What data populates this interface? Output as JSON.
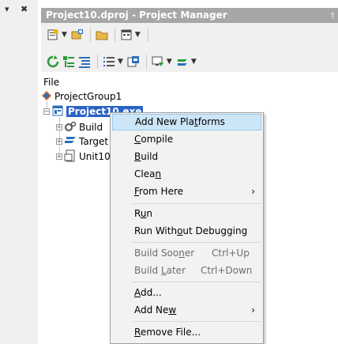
{
  "window": {
    "title": "Project10.dproj - Project Manager",
    "pin_glyph": "†"
  },
  "left_strip": {
    "dropdown_glyph": "▾",
    "close_glyph": "✖"
  },
  "tree": {
    "header": "File",
    "group": "ProjectGroup1",
    "project": "Project10.exe",
    "children": [
      "Build",
      "Target",
      "Unit10"
    ]
  },
  "menu": {
    "items": [
      {
        "pre": "Add New Pla",
        "u": "t",
        "post": "forms",
        "shortcut": "",
        "submenu": false,
        "disabled": false
      },
      {
        "pre": "",
        "u": "C",
        "post": "ompile",
        "shortcut": "",
        "submenu": false,
        "disabled": false
      },
      {
        "pre": "",
        "u": "B",
        "post": "uild",
        "shortcut": "",
        "submenu": false,
        "disabled": false
      },
      {
        "pre": "Clea",
        "u": "n",
        "post": "",
        "shortcut": "",
        "submenu": false,
        "disabled": false
      },
      {
        "pre": "",
        "u": "F",
        "post": "rom Here",
        "shortcut": "",
        "submenu": true,
        "disabled": false
      },
      {
        "pre": "R",
        "u": "u",
        "post": "n",
        "shortcut": "",
        "submenu": false,
        "disabled": false
      },
      {
        "pre": "Run With",
        "u": "o",
        "post": "ut Debugging",
        "shortcut": "",
        "submenu": false,
        "disabled": false
      },
      {
        "pre": "Build Soo",
        "u": "n",
        "post": "er",
        "shortcut": "Ctrl+Up",
        "submenu": false,
        "disabled": true
      },
      {
        "pre": "Build ",
        "u": "L",
        "post": "ater",
        "shortcut": "Ctrl+Down",
        "submenu": false,
        "disabled": true
      },
      {
        "pre": "",
        "u": "A",
        "post": "dd...",
        "shortcut": "",
        "submenu": false,
        "disabled": false
      },
      {
        "pre": "Add Ne",
        "u": "w",
        "post": "",
        "shortcut": "",
        "submenu": true,
        "disabled": false
      },
      {
        "pre": "",
        "u": "R",
        "post": "emove File...",
        "shortcut": "",
        "submenu": false,
        "disabled": false
      }
    ],
    "submenu_glyph": "›"
  },
  "colors": {
    "titlebar": "#a7a7a7",
    "selection": "#2b63c4",
    "menu_highlight": "#cde6f7"
  },
  "icons": {
    "toolbar_row1": [
      "new-item-icon",
      "add-to-project-icon",
      "open-folder-icon",
      "view-icon"
    ],
    "toolbar_row2": [
      "sync-icon",
      "expand-all-icon",
      "collapse-all-icon",
      "list-icon",
      "build-config-icon",
      "target-platform-icon",
      "build-options-icon"
    ]
  }
}
